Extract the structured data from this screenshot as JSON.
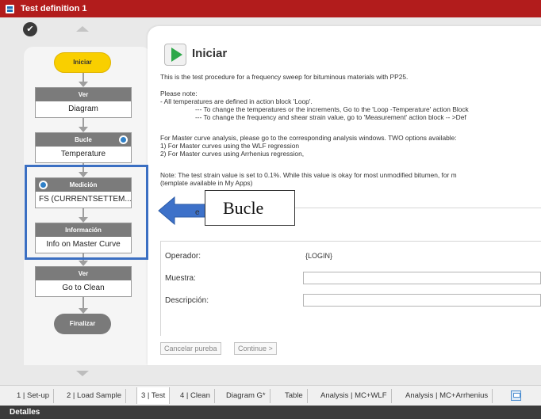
{
  "window": {
    "title": "Test definition 1"
  },
  "flow": {
    "start_label": "Iniciar",
    "end_label": "Finalizar",
    "blocks": [
      {
        "header": "Ver",
        "body": "Diagram",
        "loop": false
      },
      {
        "header": "Bucle",
        "body": "Temperature",
        "loop": true
      },
      {
        "header": "Medición",
        "body": "FS (CURRENTSETTEM...",
        "loop": true
      },
      {
        "header": "Información",
        "body": "Info on Master Curve",
        "loop": false
      },
      {
        "header": "Ver",
        "body": "Go to Clean",
        "loop": false
      }
    ],
    "callout_label": "Bucle"
  },
  "content": {
    "title": "Iniciar",
    "notes": [
      "This is the test procedure for a frequency sweep for bituminous materials with PP25.",
      "Please note:",
      "- All temperatures are defined in action block 'Loop'.",
      "--- To change the temperatures or the increments, Go to the 'Loop -Temperature' action Block",
      "--- To change the frequency and shear strain value, go to 'Measurement' action block -- >Def",
      "For Master curve analysis, please go to the corresponding analysis windows. TWO options available:",
      "1) For Master curves using the WLF regression",
      "2) For Master curves using Arrhenius regression,",
      "Note: The test strain value is set to 0.1%. While this value is okay for most unmodified bitumen, for m",
      "(template available in My Apps)"
    ],
    "partial_label": "e",
    "form": {
      "operator_label": "Operador:",
      "operator_value": "{LOGIN}",
      "sample_label": "Muestra:",
      "sample_value": "",
      "description_label": "Descripción:",
      "description_value": ""
    },
    "buttons": {
      "cancel": "Cancelar pureba",
      "continue": "Continue >"
    }
  },
  "tabs": [
    "1 | Set-up",
    "2 | Load Sample",
    "3 | Test",
    "4 | Clean",
    "Diagram G*",
    "Table",
    "Analysis | MC+WLF",
    "Analysis | MC+Arrhenius"
  ],
  "active_tab": "3 | Test",
  "statusbar": {
    "label": "Detalles"
  },
  "colors": {
    "titlebar": "#b21c1c",
    "start_node": "#f9cf00",
    "block_header": "#7b7b7b",
    "highlight": "#3b6fc2",
    "play": "#2ea84a"
  }
}
